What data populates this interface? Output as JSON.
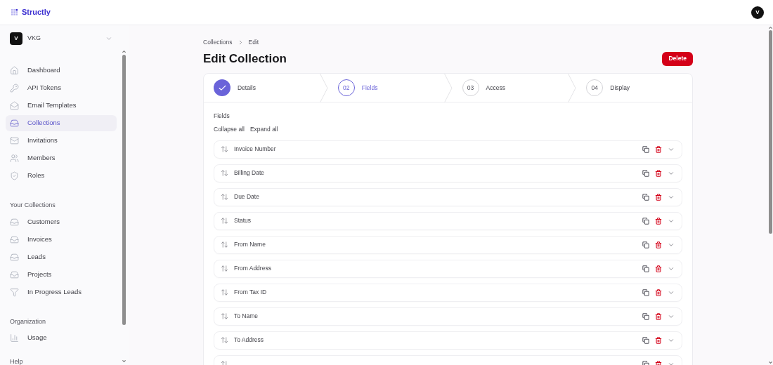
{
  "brand": "Structly",
  "user_avatar": "V",
  "workspace": {
    "initial": "V",
    "name": "VKG"
  },
  "nav": [
    {
      "label": "Dashboard",
      "selected": false
    },
    {
      "label": "API Tokens",
      "selected": false
    },
    {
      "label": "Email Templates",
      "selected": false
    },
    {
      "label": "Collections",
      "selected": true
    },
    {
      "label": "Invitations",
      "selected": false
    },
    {
      "label": "Members",
      "selected": false
    },
    {
      "label": "Roles",
      "selected": false
    }
  ],
  "your_collections": {
    "heading": "Your Collections",
    "items": [
      {
        "label": "Customers",
        "kind": "collection",
        "selected": false
      },
      {
        "label": "Invoices",
        "kind": "collection",
        "selected": false
      },
      {
        "label": "Leads",
        "kind": "collection",
        "selected": false
      },
      {
        "label": "Projects",
        "kind": "collection",
        "selected": false
      },
      {
        "label": "In Progress Leads",
        "kind": "filter",
        "selected": false
      }
    ]
  },
  "organization": {
    "heading": "Organization",
    "items": [
      {
        "label": "Usage",
        "selected": false
      }
    ]
  },
  "help_heading": "Help",
  "breadcrumb": [
    "Collections",
    "Edit"
  ],
  "title": "Edit Collection",
  "delete_button": "Delete",
  "steps": [
    {
      "label": "Details",
      "completed": true,
      "selected": false
    },
    {
      "number": "02",
      "label": "Fields",
      "completed": false,
      "selected": true
    },
    {
      "number": "03",
      "label": "Access",
      "completed": false,
      "selected": false
    },
    {
      "number": "04",
      "label": "Display",
      "completed": false,
      "selected": false
    }
  ],
  "fields_heading": "Fields",
  "collapse_all": "Collapse all",
  "expand_all": "Expand all",
  "fields": [
    {
      "name": "Invoice Number",
      "expanded": false
    },
    {
      "name": "Billing Date",
      "expanded": false
    },
    {
      "name": "Due Date",
      "expanded": false
    },
    {
      "name": "Status",
      "expanded": false
    },
    {
      "name": "From Name",
      "expanded": false
    },
    {
      "name": "From Address",
      "expanded": false
    },
    {
      "name": "From Tax ID",
      "expanded": false
    },
    {
      "name": "To Name",
      "expanded": false
    },
    {
      "name": "To Address",
      "expanded": false
    },
    {
      "expanded": false
    }
  ]
}
